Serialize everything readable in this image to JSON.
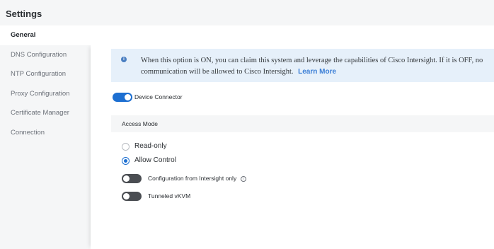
{
  "header": {
    "title": "Settings"
  },
  "sidebar": {
    "items": [
      {
        "label": "General"
      },
      {
        "label": "DNS Configuration"
      },
      {
        "label": "NTP Configuration"
      },
      {
        "label": "Proxy Configuration"
      },
      {
        "label": "Certificate Manager"
      },
      {
        "label": "Connection"
      }
    ],
    "active_index": 0
  },
  "info_banner": {
    "icon": "info-icon",
    "text": "When this option is ON, you can claim this system and leverage the capabilities of Cisco Intersight. If it is OFF, no communication will be allowed to Cisco Intersight.",
    "link_label": "Learn More"
  },
  "device_connector": {
    "label": "Device Connector",
    "enabled": true
  },
  "access_mode": {
    "heading": "Access Mode",
    "options": [
      {
        "label": "Read-only",
        "selected": false
      },
      {
        "label": "Allow Control",
        "selected": true
      }
    ]
  },
  "toggles": [
    {
      "label": "Configuration from Intersight only",
      "enabled": false,
      "icon": "help-icon"
    },
    {
      "label": "Tunneled vKVM",
      "enabled": false
    }
  ],
  "colors": {
    "accent": "#1d6fd1",
    "banner_bg": "#e6f0fa",
    "link": "#3c7fd6",
    "toggle_off": "#4a4d52"
  }
}
